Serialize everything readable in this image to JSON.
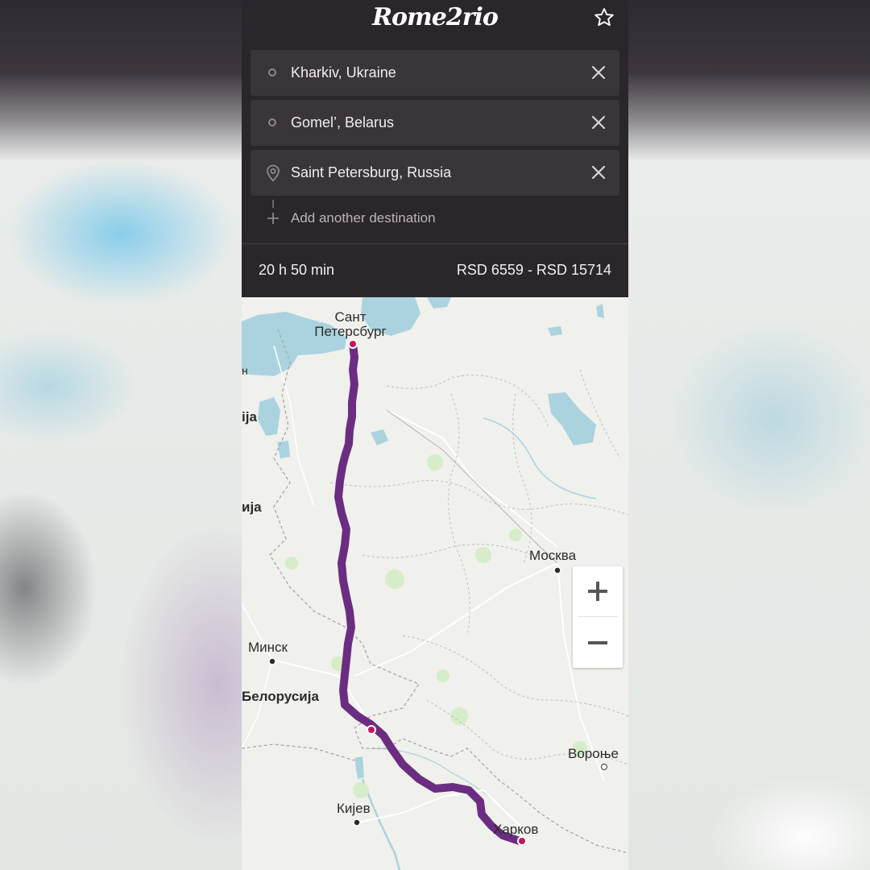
{
  "header": {
    "logo_text": "Rome2rio",
    "favorite_icon": "star-outline-icon"
  },
  "route": {
    "stops": [
      {
        "label": "Kharkiv, Ukraine",
        "icon": "circle-icon",
        "clear_icon": "close-icon"
      },
      {
        "label": "Gomel’, Belarus",
        "icon": "circle-icon",
        "clear_icon": "close-icon"
      },
      {
        "label": "Saint Petersburg, Russia",
        "icon": "location-pin-icon",
        "clear_icon": "close-icon"
      }
    ],
    "add_destination_label": "Add another destination"
  },
  "summary": {
    "duration": "20 h 50 min",
    "price_range": "RSD 6559 - RSD 15714"
  },
  "map": {
    "route_color": "#6b2d82",
    "labels": {
      "spb_line1": "Сант",
      "spb_line2": "Петерсбург",
      "moscow": "Москва",
      "minsk": "Минск",
      "belarus": "Белорусија",
      "kyiv": "Кијев",
      "kharkiv": "Харков",
      "voronezh": "Вороње",
      "edge1": "н",
      "edge2": "ija",
      "edge3": "ија"
    },
    "zoom_in_label": "+",
    "zoom_out_label": "−"
  },
  "colors": {
    "panel_bg": "#2b262c",
    "field_bg": "#3a343b",
    "water": "#aad3df",
    "land": "#f0f0ec",
    "stop_marker": "#c2185b"
  }
}
